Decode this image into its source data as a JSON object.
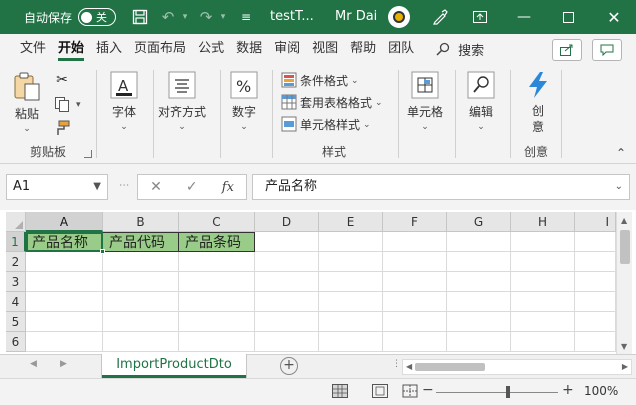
{
  "titlebar": {
    "autosave_label": "自动保存",
    "autosave_state": "关",
    "doc_title": "testT...",
    "user_name": "Mr Dai"
  },
  "tabs": [
    "文件",
    "开始",
    "插入",
    "页面布局",
    "公式",
    "数据",
    "审阅",
    "视图",
    "帮助",
    "团队"
  ],
  "active_tab": "开始",
  "search_label": "搜索",
  "ribbon": {
    "clipboard": {
      "paste": "粘贴",
      "label": "剪贴板"
    },
    "font": {
      "label": "字体"
    },
    "alignment": {
      "label": "对齐方式"
    },
    "number": {
      "label": "数字"
    },
    "styles": {
      "conditional": "条件格式",
      "table": "套用表格格式",
      "cell_styles": "单元格样式",
      "label": "样式"
    },
    "cells": {
      "label": "单元格"
    },
    "editing": {
      "label": "编辑"
    },
    "create": {
      "button": "创\n意",
      "label": "创意"
    }
  },
  "formula_bar": {
    "name_box": "A1",
    "formula": "产品名称"
  },
  "grid": {
    "columns": [
      "A",
      "B",
      "C",
      "D",
      "E",
      "F",
      "G",
      "H",
      "I"
    ],
    "rows": [
      "1",
      "2",
      "3",
      "4",
      "5",
      "6"
    ],
    "row1": [
      "产品名称",
      "产品代码",
      "产品条码"
    ],
    "active_cell": "A1"
  },
  "sheet_tab": "ImportProductDto",
  "status": {
    "zoom": "100%"
  },
  "colors": {
    "brand": "#217346",
    "header_fill": "#99cc88"
  }
}
